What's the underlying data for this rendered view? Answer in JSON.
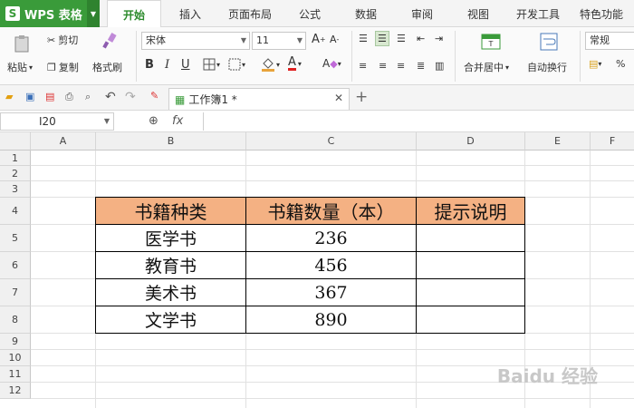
{
  "app": {
    "name": "WPS 表格",
    "logo": "S"
  },
  "menu_tabs": [
    "开始",
    "插入",
    "页面布局",
    "公式",
    "数据",
    "审阅",
    "视图",
    "开发工具",
    "特色功能"
  ],
  "ribbon": {
    "paste": "粘贴",
    "cut": "剪切",
    "copy": "复制",
    "format_painter": "格式刷",
    "font_name": "宋体",
    "font_size": "11",
    "bold": "B",
    "italic": "I",
    "underline": "U",
    "merge_center": "合并居中",
    "wrap_text": "自动换行",
    "number_format": "常规",
    "percent": "%"
  },
  "document": {
    "tab_title": "工作簿1 *"
  },
  "formula_bar": {
    "cell_ref": "I20",
    "fx": "fx"
  },
  "columns": [
    "A",
    "B",
    "C",
    "D",
    "E",
    "F"
  ],
  "rows": [
    "1",
    "2",
    "3",
    "4",
    "5",
    "6",
    "7",
    "8",
    "9",
    "10",
    "11",
    "12"
  ],
  "table": {
    "headers": [
      "书籍种类",
      "书籍数量（本）",
      "提示说明"
    ],
    "rows": [
      [
        "医学书",
        "236",
        ""
      ],
      [
        "教育书",
        "456",
        ""
      ],
      [
        "美术书",
        "367",
        ""
      ],
      [
        "文学书",
        "890",
        ""
      ]
    ],
    "header_color": "#f4b183"
  },
  "watermark": "Baidu 经验"
}
